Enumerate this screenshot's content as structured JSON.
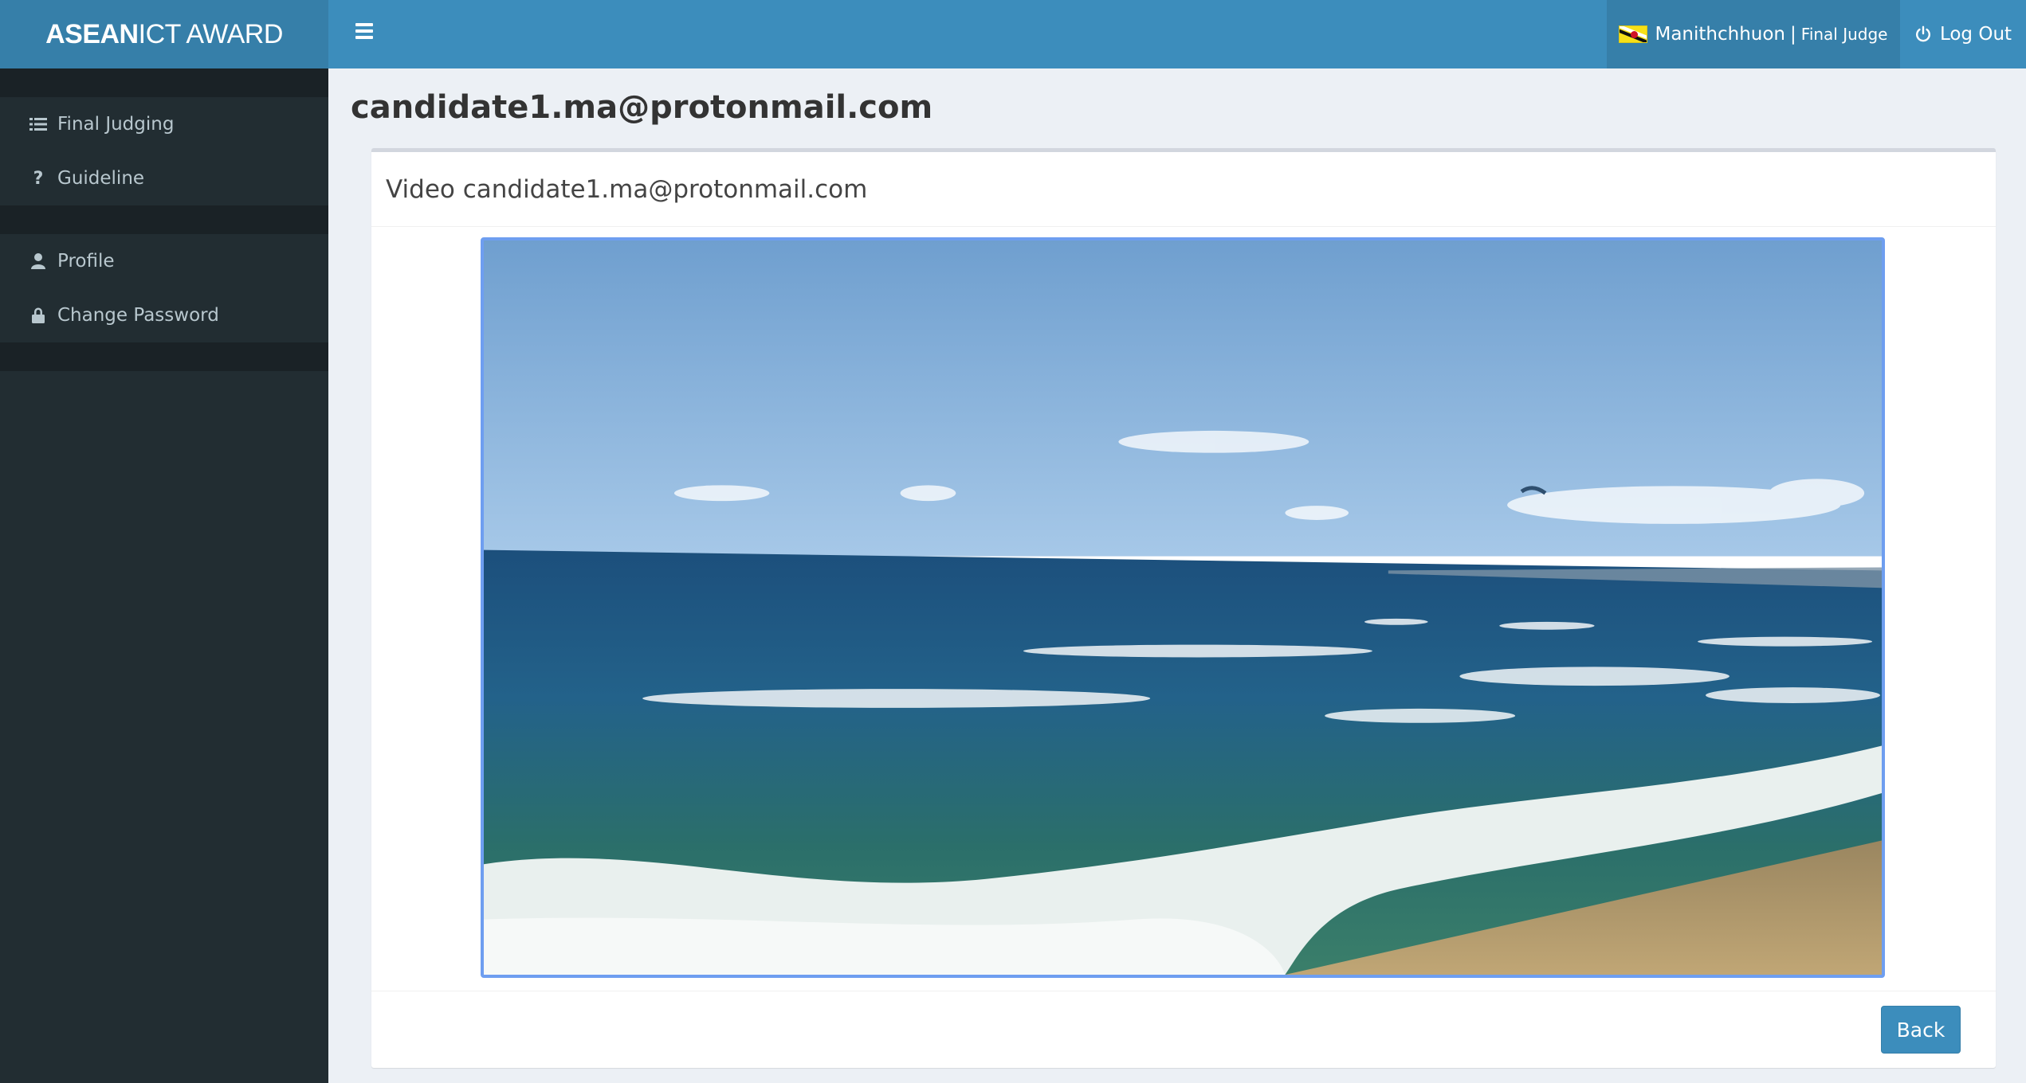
{
  "header": {
    "logo_bold": "ASEAN",
    "logo_rest": "ICT AWARD",
    "menu_toggle_icon": "hamburger-icon",
    "user_flag_icon": "brunei-flag-icon",
    "user_name": "Manithchhuon",
    "user_separator": "|",
    "user_role": "Final Judge",
    "logout_icon": "power-icon",
    "logout_label": "Log Out",
    "colors": {
      "topbar": "#3c8dbc",
      "logo_bg": "#367fa9"
    }
  },
  "sidebar": {
    "groups": [
      [
        {
          "icon": "list-icon",
          "label": "Final Judging"
        },
        {
          "icon": "question-icon",
          "label": "Guideline"
        }
      ],
      [
        {
          "icon": "user-icon",
          "label": "Profile"
        },
        {
          "icon": "lock-icon",
          "label": "Change Password"
        }
      ]
    ],
    "colors": {
      "bg": "#222d32",
      "text": "#b8c7ce"
    }
  },
  "main": {
    "page_title": "candidate1.ma@protonmail.com",
    "box_title": "Video candidate1.ma@protonmail.com",
    "video": {
      "content": "video-player",
      "focus_color": "#6e9ef0"
    },
    "back_button": "Back"
  }
}
